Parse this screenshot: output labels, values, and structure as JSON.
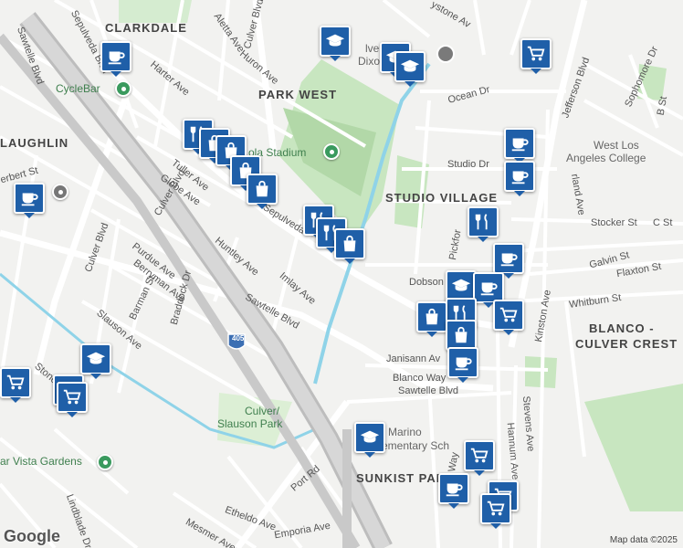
{
  "map": {
    "neighborhoods": [
      {
        "id": "clarkdale",
        "text": "CLARKDALE"
      },
      {
        "id": "park-west",
        "text": "PARK WEST"
      },
      {
        "id": "laughlin",
        "text": "LAUGHLIN"
      },
      {
        "id": "studio-village",
        "text": "STUDIO VILLAGE"
      },
      {
        "id": "blanco",
        "text": "BLANCO -"
      },
      {
        "id": "culver-crest",
        "text": "CULVER CREST"
      },
      {
        "id": "sunkist-park",
        "text": "SUNKIST PARK"
      }
    ],
    "streets": [
      {
        "id": "sepulveda-1",
        "text": "Sepulveda Blvd"
      },
      {
        "id": "sepulveda-2",
        "text": "Sepulveda"
      },
      {
        "id": "culver-1",
        "text": "Culver Blvd"
      },
      {
        "id": "culver-2",
        "text": "Culver Blvd"
      },
      {
        "id": "culver-3",
        "text": "Culver Blvd"
      },
      {
        "id": "sawtelle-1",
        "text": "Sawtelle Blvd"
      },
      {
        "id": "sawtelle-2",
        "text": "Sawtelle Blvd"
      },
      {
        "id": "sawtelle-3",
        "text": "Sawtelle Blvd"
      },
      {
        "id": "jefferson",
        "text": "Jefferson Blvd"
      },
      {
        "id": "harter",
        "text": "Harter Ave"
      },
      {
        "id": "huron",
        "text": "Huron Ave"
      },
      {
        "id": "aletta",
        "text": "Aletta Ave"
      },
      {
        "id": "tuller",
        "text": "Tuller Ave"
      },
      {
        "id": "globe",
        "text": "Globe Ave"
      },
      {
        "id": "huntley",
        "text": "Huntley Ave"
      },
      {
        "id": "imlay",
        "text": "Imlay Ave"
      },
      {
        "id": "purdue",
        "text": "Purdue Ave"
      },
      {
        "id": "berryman",
        "text": "Berryman Ave"
      },
      {
        "id": "barman",
        "text": "Barman St"
      },
      {
        "id": "braddock",
        "text": "Braddock Dr"
      },
      {
        "id": "slauson",
        "text": "Slauson Ave"
      },
      {
        "id": "ocean",
        "text": "Ocean Dr"
      },
      {
        "id": "studio",
        "text": "Studio Dr"
      },
      {
        "id": "stocker",
        "text": "Stocker St"
      },
      {
        "id": "galvin",
        "text": "Galvin St"
      },
      {
        "id": "flaxton",
        "text": "Flaxton St"
      },
      {
        "id": "whitburn",
        "text": "Whitburn St"
      },
      {
        "id": "dobson",
        "text": "Dobson"
      },
      {
        "id": "janisann",
        "text": "Janisann Av"
      },
      {
        "id": "blanco-way",
        "text": "Blanco Way"
      },
      {
        "id": "hannum",
        "text": "Hannum Ave"
      },
      {
        "id": "stevens",
        "text": "Stevens Ave"
      },
      {
        "id": "kinston",
        "text": "Kinston Ave"
      },
      {
        "id": "pickford",
        "text": "Pickfor"
      },
      {
        "id": "sophomore",
        "text": "Sophomore Dr"
      },
      {
        "id": "b-st",
        "text": "B St"
      },
      {
        "id": "c-st",
        "text": "C St"
      },
      {
        "id": "port-rd",
        "text": "Port Rd"
      },
      {
        "id": "etheldo",
        "text": "Etheldo Ave"
      },
      {
        "id": "emporia",
        "text": "Emporia Ave"
      },
      {
        "id": "mesmer",
        "text": "Mesmer Ave"
      },
      {
        "id": "lindblade",
        "text": "Lindblade Dr"
      },
      {
        "id": "herbert",
        "text": "erbert St"
      },
      {
        "id": "way",
        "text": "Way"
      },
      {
        "id": "stone",
        "text": "Stone"
      },
      {
        "id": "keystone",
        "text": "ystone Av"
      },
      {
        "id": "rland",
        "text": "rland Ave"
      },
      {
        "id": "i405",
        "text": "405"
      }
    ],
    "pois": [
      {
        "id": "cyclebar",
        "text": "CycleBar"
      },
      {
        "id": "stadium",
        "text": "ola Stadium"
      },
      {
        "id": "west-la-college-1",
        "text": "West Los"
      },
      {
        "id": "west-la-college-2",
        "text": "Angeles College"
      },
      {
        "id": "culver-slauson-1",
        "text": "Culver/"
      },
      {
        "id": "culver-slauson-2",
        "text": "Slauson Park"
      },
      {
        "id": "mar-vista-gardens",
        "text": "ar Vista Gardens"
      },
      {
        "id": "marino-1",
        "text": "Marino"
      },
      {
        "id": "marino-2",
        "text": "ementary Sch"
      },
      {
        "id": "culver-city-1",
        "text": "lver C"
      },
      {
        "id": "dixon",
        "text": "Dixo"
      }
    ],
    "pin_icons": [
      "coffee-cup",
      "graduation-cap",
      "restaurant",
      "shopping-bag",
      "shopping-cart"
    ],
    "colors": {
      "pin": "#1f5fa8",
      "park": "#c8e6c0",
      "park_dark": "#b2d8a8",
      "freeway": "#c6c6c6",
      "water": "#8fd3e8",
      "road": "#ffffff"
    },
    "footer": {
      "logo": "Google",
      "attribution": "Map data ©2025"
    }
  }
}
